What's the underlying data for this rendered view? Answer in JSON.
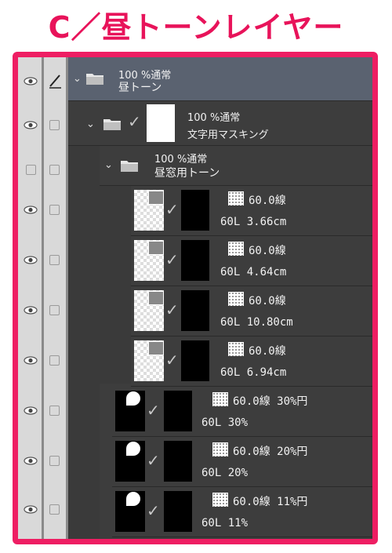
{
  "title": "C／昼トーンレイヤー",
  "colors": {
    "accent": "#ee1e63",
    "panel": "#3d3d3d",
    "selected_row": "#5a6270"
  },
  "layers": [
    {
      "id": "r0",
      "kind": "folder",
      "opacity_blend": "100 %通常",
      "name": "昼トーン"
    },
    {
      "id": "r1",
      "kind": "folder-mask",
      "opacity_blend": "100 %通常",
      "name": "文字用マスキング"
    },
    {
      "id": "r2",
      "kind": "folder",
      "opacity_blend": "100 %通常",
      "name": "昼窓用トーン"
    },
    {
      "id": "r3",
      "kind": "tone",
      "line1": "60.0線",
      "line2": "60L 3.66cm"
    },
    {
      "id": "r4",
      "kind": "tone",
      "line1": "60.0線",
      "line2": "60L 4.64cm"
    },
    {
      "id": "r5",
      "kind": "tone",
      "line1": "60.0線",
      "line2": "60L 10.80cm"
    },
    {
      "id": "r6",
      "kind": "tone",
      "line1": "60.0線",
      "line2": "60L 6.94cm"
    },
    {
      "id": "r7",
      "kind": "tone2",
      "line1": "60.0線 30%円",
      "line2": "60L 30%"
    },
    {
      "id": "r8",
      "kind": "tone2",
      "line1": "60.0線 20%円",
      "line2": "60L 20%"
    },
    {
      "id": "r9",
      "kind": "tone2",
      "line1": "60.0線 11%円",
      "line2": "60L 11%"
    }
  ]
}
